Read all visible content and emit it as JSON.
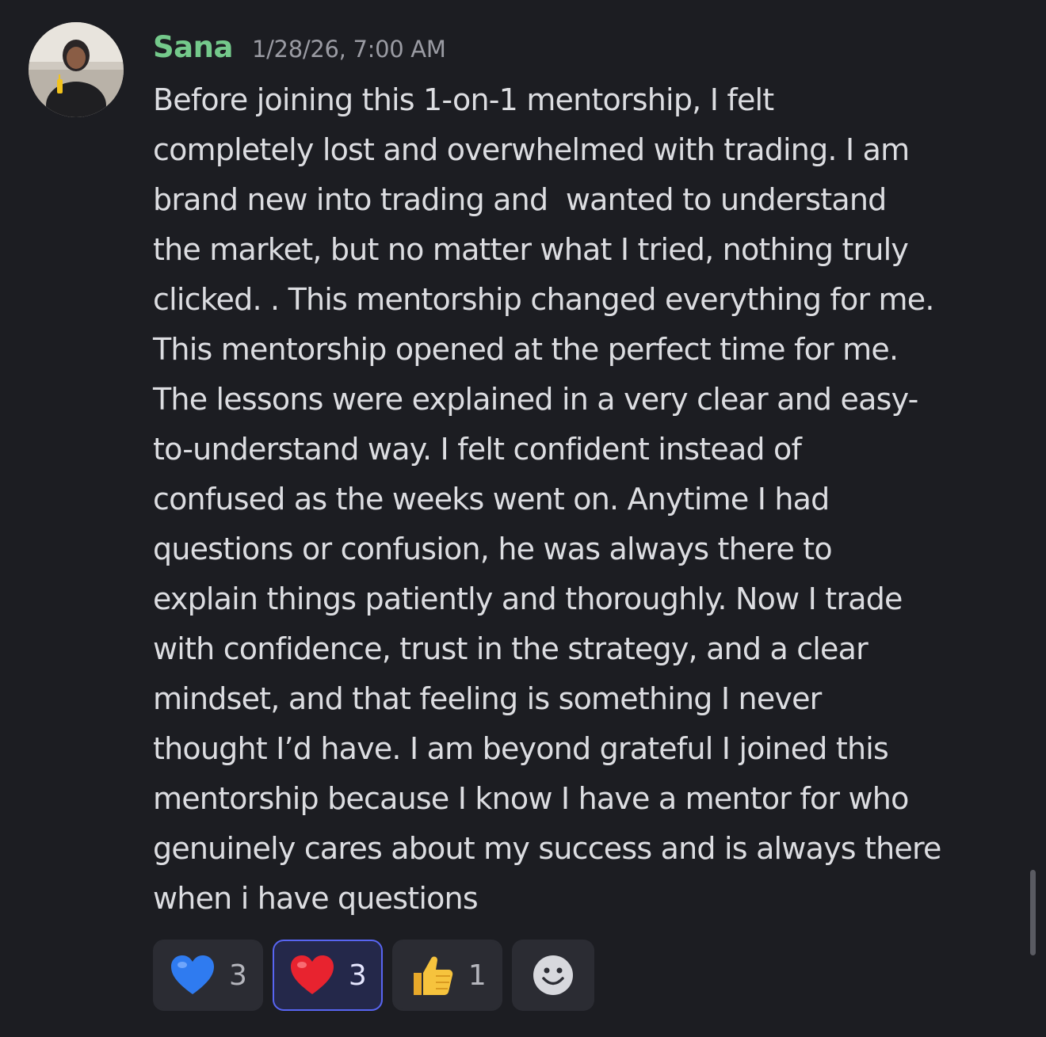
{
  "message": {
    "author": "Sana",
    "timestamp": "1/28/26, 7:00 AM",
    "lines": [
      "Before joining this 1-on-1 mentorship, I felt",
      "completely lost and overwhelmed with trading. I am",
      "brand new into trading and  wanted to understand",
      "the market, but no matter what I tried, nothing truly",
      "clicked. . This mentorship changed everything for me.",
      "This mentorship opened at the perfect time for me.",
      "The lessons were explained in a very clear and easy-",
      "to-understand way. I felt confident instead of",
      "confused as the weeks went on. Anytime I had",
      "questions or confusion, he was always there to",
      "explain things patiently and thoroughly. Now I trade",
      "with confidence, trust in the strategy, and a clear",
      "mindset, and that feeling is something I never",
      "thought I’d have. I am beyond grateful I joined this",
      "mentorship because I know I have a mentor for who",
      "genuinely cares about my success and is always there",
      "when i have questions"
    ]
  },
  "reactions": [
    {
      "emoji": "blue-heart-icon",
      "count": "3",
      "selected": false
    },
    {
      "emoji": "red-heart-icon",
      "count": "3",
      "selected": true
    },
    {
      "emoji": "thumbs-up-icon",
      "count": "1",
      "selected": false
    }
  ],
  "add_reaction": {
    "icon": "smiley-add-reaction-icon"
  },
  "colors": {
    "background": "#1c1d22",
    "username": "#74c98b",
    "timestamp": "#9a9ba3",
    "text": "#dcdde1",
    "reaction_bg": "#2b2c33",
    "reaction_selected_border": "#5865f2"
  }
}
